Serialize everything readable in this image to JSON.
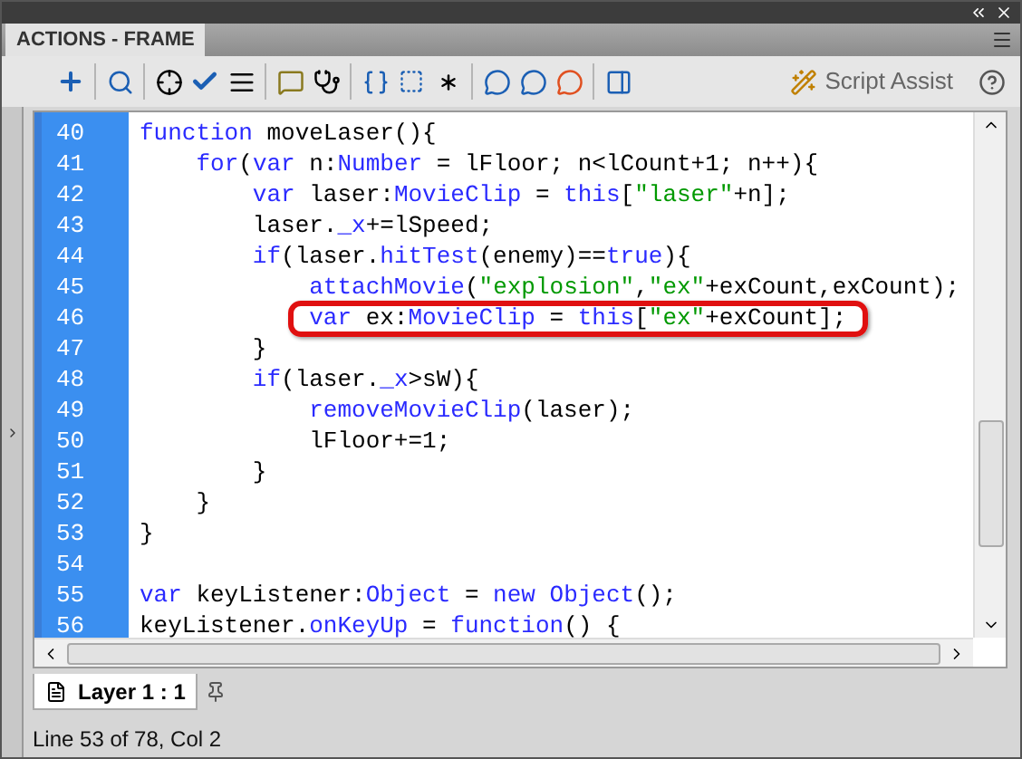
{
  "window": {
    "title": "ACTIONS - FRAME"
  },
  "toolbar": {
    "script_assist": "Script Assist"
  },
  "code": [
    {
      "number": "40",
      "highlighted": false,
      "tokens": [
        {
          "t": "function",
          "kind": "kw"
        },
        {
          "t": " moveLaser(){",
          "kind": "plain"
        }
      ]
    },
    {
      "number": "41",
      "highlighted": false,
      "tokens": [
        {
          "t": "    for",
          "kind": "kw"
        },
        {
          "t": "(",
          "kind": "plain"
        },
        {
          "t": "var",
          "kind": "kw"
        },
        {
          "t": " n:",
          "kind": "plain"
        },
        {
          "t": "Number",
          "kind": "kw"
        },
        {
          "t": " = lFloor; n<lCount+1; n++){",
          "kind": "plain"
        }
      ]
    },
    {
      "number": "42",
      "highlighted": false,
      "tokens": [
        {
          "t": "        var",
          "kind": "kw"
        },
        {
          "t": " laser:",
          "kind": "plain"
        },
        {
          "t": "MovieClip",
          "kind": "kw"
        },
        {
          "t": " = ",
          "kind": "plain"
        },
        {
          "t": "this",
          "kind": "kw"
        },
        {
          "t": "[",
          "kind": "plain"
        },
        {
          "t": "\"laser\"",
          "kind": "str"
        },
        {
          "t": "+n];",
          "kind": "plain"
        }
      ]
    },
    {
      "number": "43",
      "highlighted": false,
      "tokens": [
        {
          "t": "        laser.",
          "kind": "plain"
        },
        {
          "t": "_x",
          "kind": "kw"
        },
        {
          "t": "+=lSpeed;",
          "kind": "plain"
        }
      ]
    },
    {
      "number": "44",
      "highlighted": false,
      "tokens": [
        {
          "t": "        if",
          "kind": "kw"
        },
        {
          "t": "(laser.",
          "kind": "plain"
        },
        {
          "t": "hitTest",
          "kind": "kw"
        },
        {
          "t": "(enemy)==",
          "kind": "plain"
        },
        {
          "t": "true",
          "kind": "kw"
        },
        {
          "t": "){",
          "kind": "plain"
        }
      ]
    },
    {
      "number": "45",
      "highlighted": false,
      "tokens": [
        {
          "t": "            attachMovie",
          "kind": "kw"
        },
        {
          "t": "(",
          "kind": "plain"
        },
        {
          "t": "\"explosion\"",
          "kind": "str"
        },
        {
          "t": ",",
          "kind": "plain"
        },
        {
          "t": "\"ex\"",
          "kind": "str"
        },
        {
          "t": "+exCount,exCount);",
          "kind": "plain"
        }
      ]
    },
    {
      "number": "46",
      "highlighted": true,
      "tokens": [
        {
          "t": "            var",
          "kind": "kw"
        },
        {
          "t": " ex:",
          "kind": "plain"
        },
        {
          "t": "MovieClip",
          "kind": "kw"
        },
        {
          "t": " = ",
          "kind": "plain"
        },
        {
          "t": "this",
          "kind": "kw"
        },
        {
          "t": "[",
          "kind": "plain"
        },
        {
          "t": "\"ex\"",
          "kind": "str"
        },
        {
          "t": "+exCount];",
          "kind": "plain"
        }
      ]
    },
    {
      "number": "47",
      "highlighted": false,
      "tokens": [
        {
          "t": "        }",
          "kind": "plain"
        }
      ]
    },
    {
      "number": "48",
      "highlighted": false,
      "tokens": [
        {
          "t": "        if",
          "kind": "kw"
        },
        {
          "t": "(laser.",
          "kind": "plain"
        },
        {
          "t": "_x",
          "kind": "kw"
        },
        {
          "t": ">sW){",
          "kind": "plain"
        }
      ]
    },
    {
      "number": "49",
      "highlighted": false,
      "tokens": [
        {
          "t": "            removeMovieClip",
          "kind": "kw"
        },
        {
          "t": "(laser);",
          "kind": "plain"
        }
      ]
    },
    {
      "number": "50",
      "highlighted": false,
      "tokens": [
        {
          "t": "            lFloor+=1;",
          "kind": "plain"
        }
      ]
    },
    {
      "number": "51",
      "highlighted": false,
      "tokens": [
        {
          "t": "        }",
          "kind": "plain"
        }
      ]
    },
    {
      "number": "52",
      "highlighted": false,
      "tokens": [
        {
          "t": "    }",
          "kind": "plain"
        }
      ]
    },
    {
      "number": "53",
      "highlighted": false,
      "tokens": [
        {
          "t": "}",
          "kind": "plain"
        }
      ]
    },
    {
      "number": "54",
      "highlighted": false
    },
    {
      "number": "55",
      "highlighted": false,
      "tokens": [
        {
          "t": "var",
          "kind": "kw"
        },
        {
          "t": " keyListener:",
          "kind": "plain"
        },
        {
          "t": "Object",
          "kind": "kw"
        },
        {
          "t": " = ",
          "kind": "plain"
        },
        {
          "t": "new ",
          "kind": "kw"
        },
        {
          "t": "Object",
          "kind": "kw"
        },
        {
          "t": "();",
          "kind": "plain"
        }
      ]
    },
    {
      "number": "56",
      "highlighted": false,
      "tokens": [
        {
          "t": "keyListener.",
          "kind": "plain"
        },
        {
          "t": "onKeyUp",
          "kind": "kw"
        },
        {
          "t": " = ",
          "kind": "plain"
        },
        {
          "t": "function",
          "kind": "kw"
        },
        {
          "t": "() {",
          "kind": "plain"
        }
      ]
    }
  ],
  "layer_tab": {
    "label": "Layer 1 : 1"
  },
  "status_bar": "Line 53 of 78, Col 2"
}
